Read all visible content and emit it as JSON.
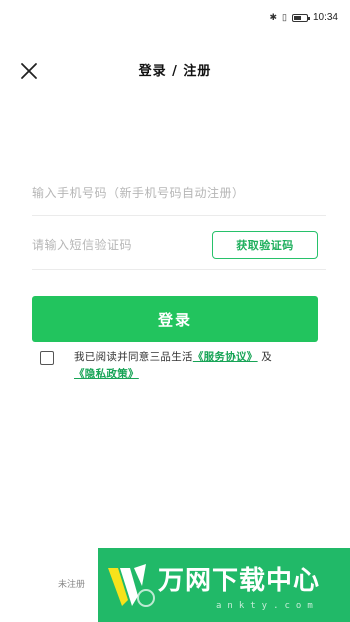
{
  "status_bar": {
    "icons": [
      "bluetooth-icon",
      "vibrate-icon",
      "battery-icon"
    ],
    "glyphs": {
      "bluetooth": "✱",
      "vibrate": "▯"
    },
    "battery_level": 0.6,
    "time": "10:34"
  },
  "header": {
    "title": "登录 / 注册",
    "close_icon": "close-icon"
  },
  "form": {
    "phone_placeholder": "输入手机号码（新手机号码自动注册）",
    "phone_value": "",
    "code_placeholder": "请输入短信验证码",
    "code_value": "",
    "get_code_label": "获取验证码",
    "login_label": "登录"
  },
  "agreement": {
    "checked": false,
    "prefix": "我已阅读并同意三品生活",
    "service_link": "《服务协议》",
    "conjunction": "及",
    "privacy_link": "《隐私政策》"
  },
  "footer": {
    "note": "未注册"
  },
  "watermark": {
    "title": "万网下载中心",
    "subtitle": "ankty.com"
  },
  "colors": {
    "accent": "#22c45e",
    "link": "#17a456",
    "watermark": "#21b968"
  }
}
